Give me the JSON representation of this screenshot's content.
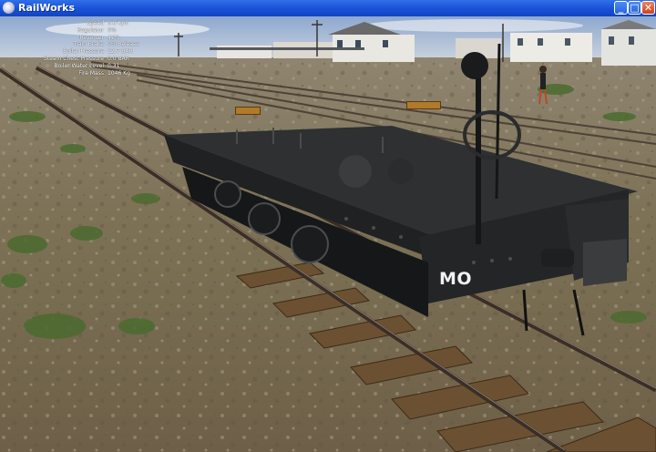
{
  "window": {
    "title": "RailWorks",
    "minimize_glyph": "_",
    "maximize_glyph": "□",
    "close_glyph": "✕"
  },
  "hud": {
    "speed": {
      "label": "Speed",
      "value": "0.0 Kph"
    },
    "regulator": {
      "label": "Regulator",
      "value": "0%"
    },
    "reverser": {
      "label": "Reverser",
      "value": "41%"
    },
    "train_brake": {
      "label": "Train Brake",
      "value": "0% Release"
    },
    "boiler_pressure": {
      "label": "Boiler Pressure",
      "value": "12.7 BAR"
    },
    "steam_chest_pressure": {
      "label": "Steam Chest Pressure",
      "value": "0.0 BAR"
    },
    "boiler_water_level": {
      "label": "Boiler Water Level",
      "value": "0.31"
    },
    "fire_mass": {
      "label": "Fire Mass",
      "value": "1046 Kg"
    }
  },
  "scene": {
    "wagon_code": "MO",
    "sign_a": "",
    "sign_b": ""
  },
  "colors": {
    "titlebar": "#1851d6",
    "sky": "#b9c8de",
    "ground": "#7a6e52",
    "wagon": "#2b2d2e",
    "rail": "#4a3a2e"
  }
}
